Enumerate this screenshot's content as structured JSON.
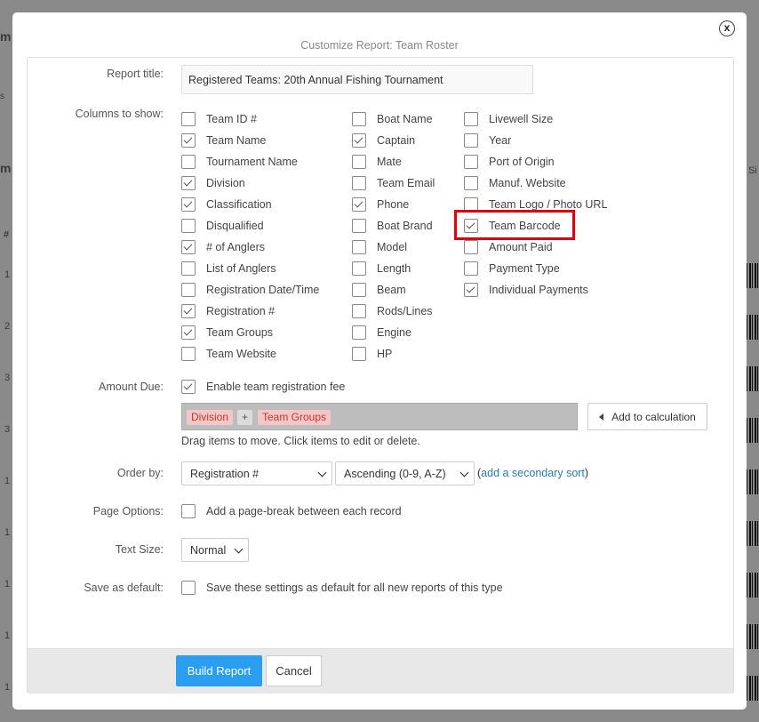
{
  "background": {
    "texts": [
      "m",
      "s",
      "m",
      "#",
      "1",
      "2",
      "3",
      "3",
      "1",
      "1",
      "1",
      "1",
      "1"
    ],
    "right_text": "Si"
  },
  "modal": {
    "title": "Customize Report: Team Roster",
    "close_glyph": "x",
    "report_title": {
      "label": "Report title:",
      "value": "Registered Teams: 20th Annual Fishing Tournament"
    },
    "columns": {
      "label": "Columns to show:",
      "col1": [
        {
          "label": "Team ID #",
          "checked": false
        },
        {
          "label": "Team Name",
          "checked": true
        },
        {
          "label": "Tournament Name",
          "checked": false
        },
        {
          "label": "Division",
          "checked": true
        },
        {
          "label": "Classification",
          "checked": true
        },
        {
          "label": "Disqualified",
          "checked": false
        },
        {
          "label": "# of Anglers",
          "checked": true
        },
        {
          "label": "List of Anglers",
          "checked": false
        },
        {
          "label": "Registration Date/Time",
          "checked": false
        },
        {
          "label": "Registration #",
          "checked": true
        },
        {
          "label": "Team Groups",
          "checked": true
        },
        {
          "label": "Team Website",
          "checked": false
        }
      ],
      "col2": [
        {
          "label": "Boat Name",
          "checked": false
        },
        {
          "label": "Captain",
          "checked": true
        },
        {
          "label": "Mate",
          "checked": false
        },
        {
          "label": "Team Email",
          "checked": false
        },
        {
          "label": "Phone",
          "checked": true
        },
        {
          "label": "Boat Brand",
          "checked": false
        },
        {
          "label": "Model",
          "checked": false
        },
        {
          "label": "Length",
          "checked": false
        },
        {
          "label": "Beam",
          "checked": false
        },
        {
          "label": "Rods/Lines",
          "checked": false
        },
        {
          "label": "Engine",
          "checked": false
        },
        {
          "label": "HP",
          "checked": false
        }
      ],
      "col3": [
        {
          "label": "Livewell Size",
          "checked": false
        },
        {
          "label": "Year",
          "checked": false
        },
        {
          "label": "Port of Origin",
          "checked": false
        },
        {
          "label": "Manuf. Website",
          "checked": false
        },
        {
          "label": "Team Logo / Photo URL",
          "checked": false
        },
        {
          "label": "Team Barcode",
          "checked": true
        },
        {
          "label": "Amount Paid",
          "checked": false
        },
        {
          "label": "Payment Type",
          "checked": false
        },
        {
          "label": "Individual Payments",
          "checked": true
        }
      ]
    },
    "amount_due": {
      "label": "Amount Due:",
      "checkbox_label": "Enable team registration fee",
      "checked": true,
      "chips": [
        "Division",
        "+",
        "Team Groups"
      ],
      "add_button": "Add to calculation",
      "hint": "Drag items to move. Click items to edit or delete."
    },
    "order_by": {
      "label": "Order by:",
      "field": "Registration #",
      "direction": "Ascending (0-9, A-Z)",
      "paren_open": "(",
      "secondary_link": "add a secondary sort",
      "paren_close": ")"
    },
    "page_options": {
      "label": "Page Options:",
      "checkbox_label": "Add a page-break between each record",
      "checked": false
    },
    "text_size": {
      "label": "Text Size:",
      "value": "Normal"
    },
    "save_default": {
      "label": "Save as default:",
      "checkbox_label": "Save these settings as default for all new reports of this type",
      "checked": false
    },
    "buttons": {
      "build": "Build Report",
      "cancel": "Cancel"
    }
  }
}
